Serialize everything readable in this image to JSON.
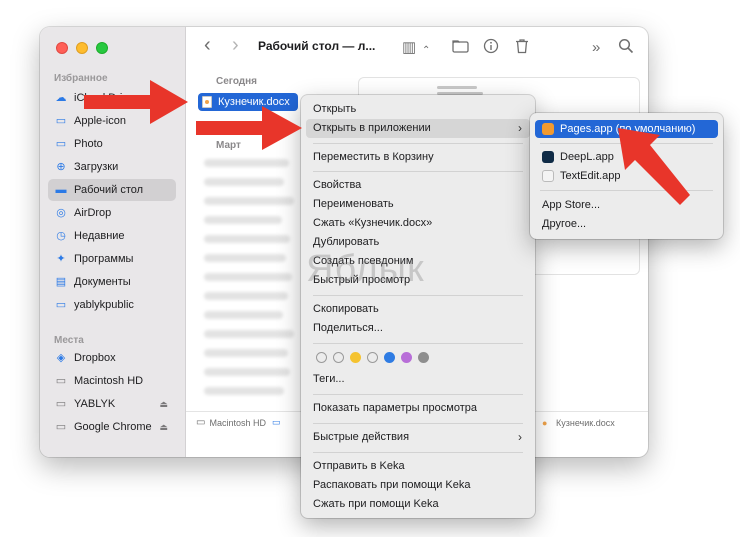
{
  "sidebar": {
    "favorites_label": "Избранное",
    "places_label": "Места",
    "favorites": [
      {
        "label": "iCloud Drive",
        "icon": "cloud-icon"
      },
      {
        "label": "Apple-icon",
        "icon": "folder-icon"
      },
      {
        "label": "Photo",
        "icon": "folder-icon"
      },
      {
        "label": "Загрузки",
        "icon": "download-icon"
      },
      {
        "label": "Рабочий стол",
        "icon": "desktop-icon"
      },
      {
        "label": "AirDrop",
        "icon": "airdrop-icon"
      },
      {
        "label": "Недавние",
        "icon": "clock-icon"
      },
      {
        "label": "Программы",
        "icon": "apps-icon"
      },
      {
        "label": "Документы",
        "icon": "document-icon"
      },
      {
        "label": "yablykpublic",
        "icon": "folder-icon"
      }
    ],
    "places": [
      {
        "label": "Dropbox",
        "icon": "dropbox-icon"
      },
      {
        "label": "Macintosh HD",
        "icon": "disk-icon"
      },
      {
        "label": "YABLYK",
        "icon": "disk-icon",
        "eject": "⏏"
      },
      {
        "label": "Google Chrome",
        "icon": "disk-icon",
        "eject": "⏏"
      }
    ]
  },
  "toolbar": {
    "back": "‹",
    "forward": "›",
    "title": "Рабочий стол — л...",
    "view_icon": "▥",
    "view_chevron": "⌃",
    "more": "»"
  },
  "content": {
    "today_label": "Сегодня",
    "march_label": "Март",
    "selected_file": "Кузнечик.docx"
  },
  "pathbar": {
    "disk": "Macintosh HD",
    "file": "Кузнечик.docx"
  },
  "context_menu": {
    "open": "Открыть",
    "open_with": "Открыть в приложении",
    "trash": "Переместить в Корзину",
    "properties": "Свойства",
    "rename": "Переименовать",
    "compress": "Сжать «Кузнечик.docx»",
    "duplicate": "Дублировать",
    "alias": "Создать псевдоним",
    "quick_look": "Быстрый просмотр",
    "copy": "Скопировать",
    "share": "Поделиться...",
    "tags": "Теги...",
    "view_options": "Показать параметры просмотра",
    "quick_actions": "Быстрые действия",
    "keka_send": "Отправить в Keka",
    "keka_extract": "Распаковать при помощи Keka",
    "keka_compress": "Сжать при помощи Keka",
    "tag_colors": [
      "#ffffff",
      "#ffffff",
      "#f5c330",
      "#ffffff",
      "#2f7ce3",
      "#b86ed8",
      "#8e8e8e"
    ]
  },
  "submenu": {
    "pages": "Pages.app (по умолчанию)",
    "deepl": "DeepL.app",
    "textedit": "TextEdit.app",
    "app_store": "App Store...",
    "other": "Другое..."
  },
  "watermark": "Яблык",
  "colors": {
    "selection": "#2367d6",
    "arrow": "#e8352a"
  }
}
